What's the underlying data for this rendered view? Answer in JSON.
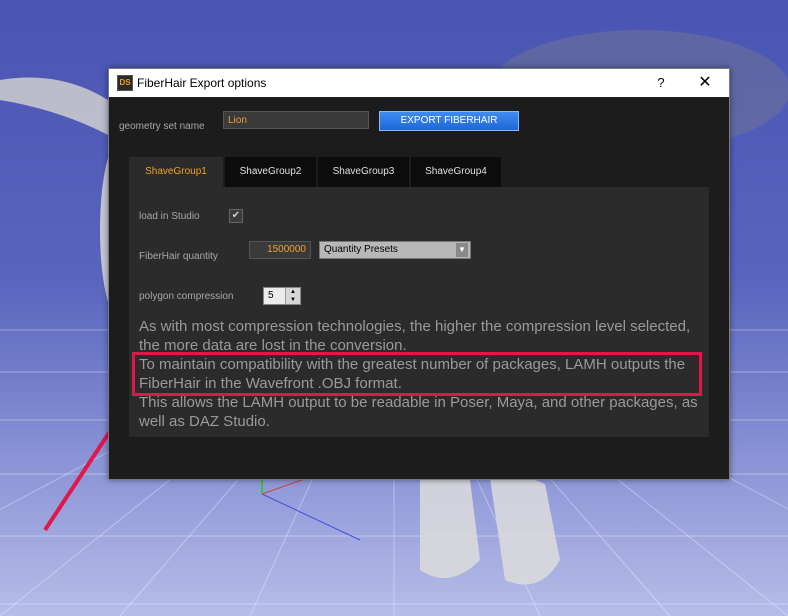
{
  "window": {
    "title": "FiberHair Export options",
    "icon_text": "DS",
    "help_label": "?",
    "close_label": "✕"
  },
  "form": {
    "geometry_label": "geometry set name",
    "geometry_value": "Lion",
    "export_label": "EXPORT FIBERHAIR"
  },
  "tabs": [
    {
      "label": "ShaveGroup1",
      "active": true
    },
    {
      "label": "ShaveGroup2",
      "active": false
    },
    {
      "label": "ShaveGroup3",
      "active": false
    },
    {
      "label": "ShaveGroup4",
      "active": false
    }
  ],
  "panel": {
    "load_label": "load in Studio",
    "load_checked": "✔",
    "quantity_label": "FiberHair quantity",
    "quantity_value": "1500000",
    "preset_label": "Quantity Presets",
    "compression_label": "polygon compression",
    "compression_value": "5",
    "description": [
      "As with most compression technologies, the higher the compression level selected, the more data are lost in the conversion.",
      "To maintain compatibility with the greatest number of packages, LAMH outputs the FiberHair in the Wavefront .OBJ format.",
      "This allows the LAMH output to be readable in Poser, Maya, and other packages, as well as DAZ Studio."
    ]
  },
  "colors": {
    "accent": "#f0a030",
    "highlight": "#e0174a",
    "export_button": "#1e66d8"
  }
}
